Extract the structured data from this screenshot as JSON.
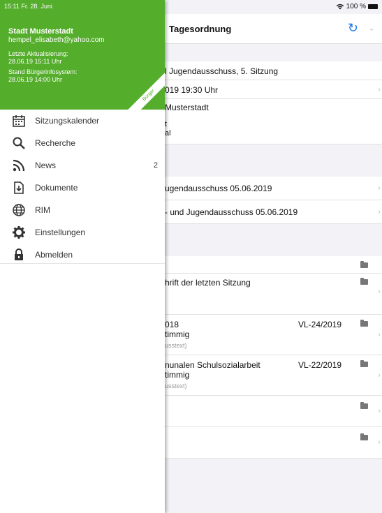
{
  "status_bar": {
    "time_date": "15:11  Fr. 28. Juni",
    "battery": "100 %"
  },
  "drawer": {
    "organization": "Stadt Musterstadt",
    "email": "hempel_elisabeth@yahoo.com",
    "last_update_label": "Letzte Aktualisierung:",
    "last_update_value": "28.06.19 15:11 Uhr",
    "system_state_label": "Stand Bürgerinfosystem:",
    "system_state_value": "28.06.19 14:00 Uhr",
    "ribbon": "Bürger",
    "accent_color": "#54ad2b",
    "menu": [
      {
        "label": "Sitzungskalender",
        "icon": "calendar-icon",
        "count": ""
      },
      {
        "label": "Recherche",
        "icon": "search-icon",
        "count": ""
      },
      {
        "label": "News",
        "icon": "rss-icon",
        "count": "2"
      },
      {
        "label": "Dokumente",
        "icon": "document-icon",
        "count": ""
      },
      {
        "label": "RIM",
        "icon": "globe-icon",
        "count": ""
      },
      {
        "label": "Einstellungen",
        "icon": "gear-icon",
        "count": ""
      },
      {
        "label": "Abmelden",
        "icon": "lock-icon",
        "count": ""
      }
    ]
  },
  "main": {
    "title": "Tagesordnung",
    "cells": {
      "meeting_name": "l Jugendausschuss, 5. Sitzung",
      "meeting_date": "019 19:30 Uhr",
      "location_1": "Musterstadt",
      "location_2": "t",
      "location_3": "al",
      "doc_1": "ugendausschuss 05.06.2019",
      "doc_2": "- und Jugendausschuss 05.06.2019",
      "agenda_1": "hrift der letzten Sitzung",
      "agenda_2_line1": "018",
      "agenda_2_line2": "timmig",
      "agenda_2_small": "usstext)",
      "agenda_2_vl": "VL-24/2019",
      "agenda_3_line1": "nunalen Schulsozialarbeit",
      "agenda_3_line2": "timmig",
      "agenda_3_small": "usstext)",
      "agenda_3_vl": "VL-22/2019"
    }
  }
}
